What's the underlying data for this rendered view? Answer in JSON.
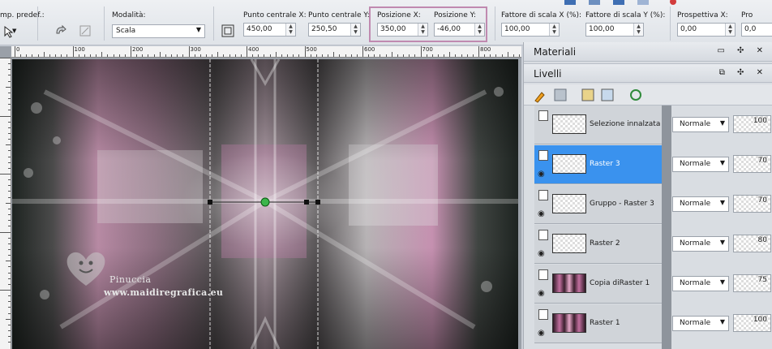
{
  "toolbar": {
    "preset_label": "mp. predef.:",
    "mode_label": "Modalità:",
    "mode_value": "Scala",
    "center_x_label": "Punto centrale X:",
    "center_x_value": "450,00",
    "center_y_label": "Punto centrale Y:",
    "center_y_value": "250,50",
    "pos_x_label": "Posizione X:",
    "pos_x_value": "350,00",
    "pos_y_label": "Posizione Y:",
    "pos_y_value": "-46,00",
    "scale_x_label": "Fattore di scala X (%):",
    "scale_x_value": "100,00",
    "scale_y_label": "Fattore di scala Y (%):",
    "scale_y_value": "100,00",
    "perspective_label": "Prospettiva X:",
    "perspective_value": "0,00",
    "cut_label": "Pro",
    "cut_value": "0,0"
  },
  "ruler": {
    "labels": [
      "0",
      "100",
      "200",
      "300",
      "400",
      "500",
      "600",
      "700",
      "800"
    ]
  },
  "watermark": {
    "name": "Pinuccia",
    "url": "www.maidiregrafica.eu"
  },
  "panels": {
    "materials_title": "Materiali",
    "layers_title": "Livelli"
  },
  "layers": [
    {
      "name": "Selezione innalzata",
      "blend": "Normale",
      "opacity": "100"
    },
    {
      "name": "Raster 3",
      "blend": "Normale",
      "opacity": "70"
    },
    {
      "name": "Gruppo - Raster 3",
      "blend": "Normale",
      "opacity": "70"
    },
    {
      "name": "Raster 2",
      "blend": "Normale",
      "opacity": "80"
    },
    {
      "name": "Copia diRaster 1",
      "blend": "Normale",
      "opacity": "75"
    },
    {
      "name": "Raster 1",
      "blend": "Normale",
      "opacity": "100"
    }
  ],
  "colors": {
    "accent_selected": "#3a92ee",
    "highlight": "#c08ab0"
  }
}
